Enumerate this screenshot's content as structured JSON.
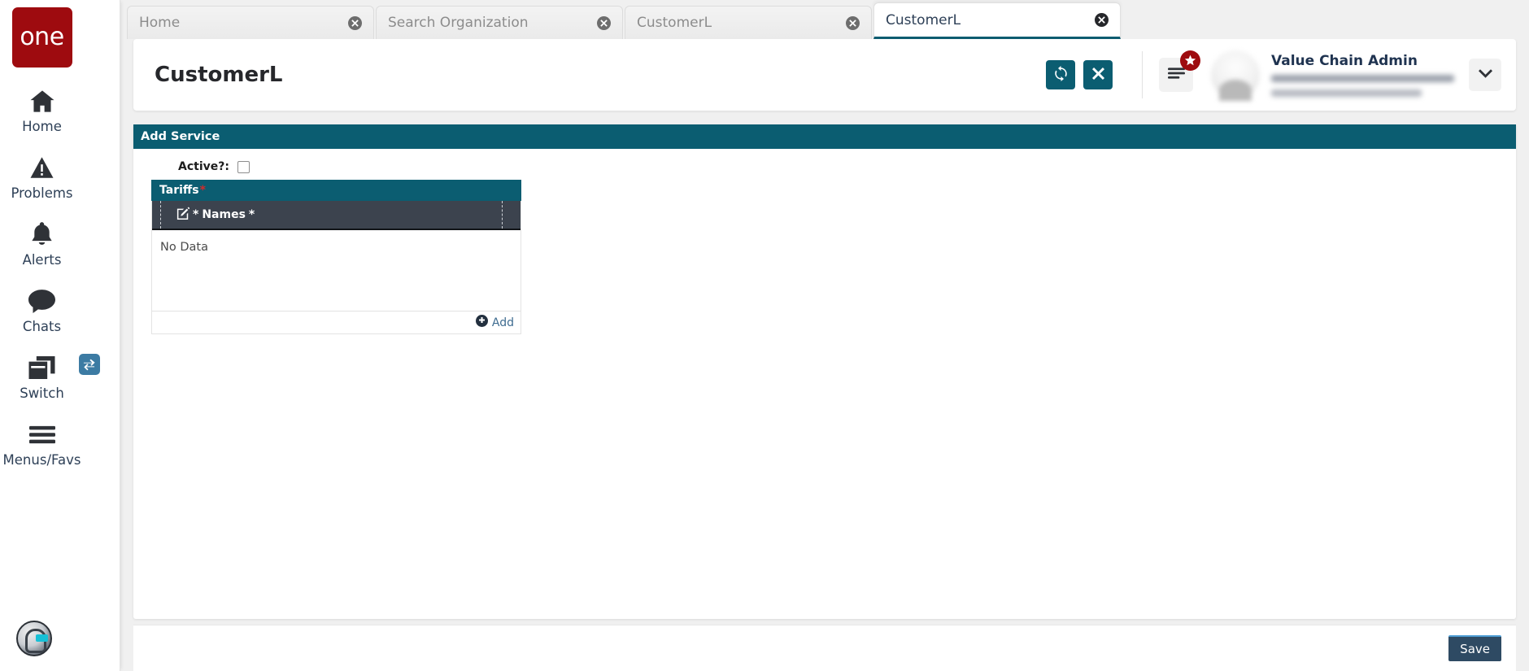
{
  "sidebar": {
    "logo_text": "one",
    "items": [
      {
        "label": "Home",
        "icon": "home-icon"
      },
      {
        "label": "Problems",
        "icon": "warning-triangle-icon"
      },
      {
        "label": "Alerts",
        "icon": "bell-icon"
      },
      {
        "label": "Chats",
        "icon": "chat-bubble-icon"
      },
      {
        "label": "Switch",
        "icon": "windows-switch-icon"
      },
      {
        "label": "Menus/Favs",
        "icon": "hamburger-icon"
      }
    ]
  },
  "tabs": [
    {
      "label": "Home",
      "active": false
    },
    {
      "label": "Search Organization",
      "active": false
    },
    {
      "label": "CustomerL",
      "active": false
    },
    {
      "label": "CustomerL",
      "active": true
    }
  ],
  "header": {
    "title": "CustomerL",
    "refresh_label": "Refresh",
    "close_label": "Close",
    "user_name": "Value Chain Admin"
  },
  "panel": {
    "title": "Add Service",
    "active_label": "Active?:",
    "active_checked": false,
    "tariffs": {
      "title": "Tariffs",
      "required_mark": "*",
      "column_header": "Names",
      "column_required_mark": "*",
      "column_edit_mark": "*",
      "empty_text": "No Data",
      "add_label": "Add",
      "rows": []
    }
  },
  "footer": {
    "save_label": "Save"
  },
  "colors": {
    "teal": "#0b5d71",
    "brand_red": "#9e0b0f",
    "grid_header": "#3c434e",
    "save_blue": "#2e4a63",
    "required_red": "#d22b2b"
  }
}
